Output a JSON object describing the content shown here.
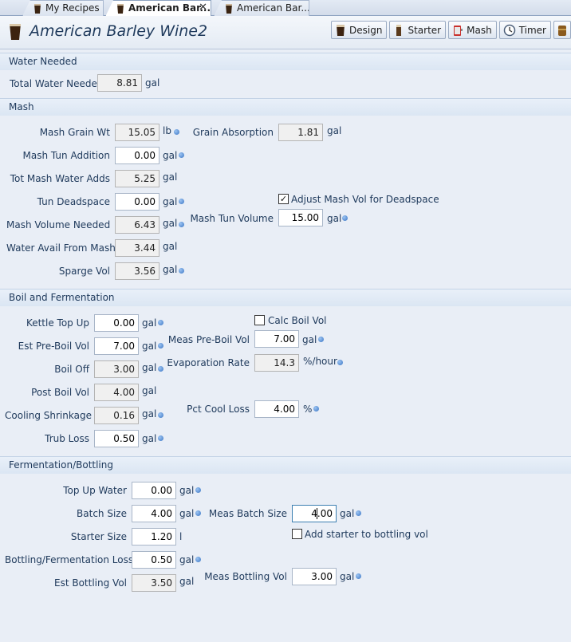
{
  "tabs": [
    {
      "label": "My Recipes"
    },
    {
      "label": "American Bar...",
      "close": "✕"
    },
    {
      "label": "American Bar..."
    }
  ],
  "header": {
    "title": "American Barley Wine2",
    "toolbar": [
      "Design",
      "Starter",
      "Mash",
      "Timer"
    ]
  },
  "water": {
    "section": "Water Needed",
    "total_label": "Total Water Needed",
    "total_value": "8.81",
    "total_unit": "gal"
  },
  "mash": {
    "section": "Mash",
    "grain_wt_label": "Mash Grain Wt",
    "grain_wt_value": "15.05",
    "grain_wt_unit": "lb",
    "absorption_label": "Grain Absorption",
    "absorption_value": "1.81",
    "absorption_unit": "gal",
    "tun_addition_label": "Mash Tun Addition",
    "tun_addition_value": "0.00",
    "tun_addition_unit": "gal",
    "water_adds_label": "Tot Mash Water Adds",
    "water_adds_value": "5.25",
    "water_adds_unit": "gal",
    "deadspace_label": "Tun Deadspace",
    "deadspace_value": "0.00",
    "deadspace_unit": "gal",
    "adjust_label": "Adjust Mash Vol for Deadspace",
    "adjust_checked": "✓",
    "volume_needed_label": "Mash Volume Needed",
    "volume_needed_value": "6.43",
    "volume_needed_unit": "gal",
    "tun_volume_label": "Mash Tun Volume",
    "tun_volume_value": "15.00",
    "tun_volume_unit": "gal",
    "avail_label": "Water Avail From Mash",
    "avail_value": "3.44",
    "avail_unit": "gal",
    "sparge_label": "Sparge Vol",
    "sparge_value": "3.56",
    "sparge_unit": "gal"
  },
  "boil": {
    "section": "Boil and Fermentation",
    "kettle_label": "Kettle Top Up",
    "kettle_value": "0.00",
    "kettle_unit": "gal",
    "calc_label": "Calc Boil Vol",
    "est_pre_label": "Est Pre-Boil Vol",
    "est_pre_value": "7.00",
    "est_pre_unit": "gal",
    "meas_pre_label": "Meas Pre-Boil Vol",
    "meas_pre_value": "7.00",
    "meas_pre_unit": "gal",
    "boil_off_label": "Boil Off",
    "boil_off_value": "3.00",
    "boil_off_unit": "gal",
    "evap_label": "Evaporation Rate",
    "evap_value": "14.3",
    "evap_unit": "%/hour",
    "post_label": "Post Boil Vol",
    "post_value": "4.00",
    "post_unit": "gal",
    "shrink_label": "Cooling Shrinkage",
    "shrink_value": "0.16",
    "shrink_unit": "gal",
    "cool_loss_label": "Pct Cool Loss",
    "cool_loss_value": "4.00",
    "cool_loss_unit": "%",
    "trub_label": "Trub Loss",
    "trub_value": "0.50",
    "trub_unit": "gal"
  },
  "ferm": {
    "section": "Fermentation/Bottling",
    "topup_label": "Top Up Water",
    "topup_value": "0.00",
    "topup_unit": "gal",
    "batch_label": "Batch Size",
    "batch_value": "4.00",
    "batch_unit": "gal",
    "meas_batch_label": "Meas Batch Size",
    "meas_batch_value": "4.00",
    "meas_batch_unit": "gal",
    "starter_label": "Starter Size",
    "starter_value": "1.20",
    "starter_unit": "l",
    "add_starter_label": "Add starter to bottling vol",
    "loss_label": "Bottling/Fermentation Loss",
    "loss_value": "0.50",
    "loss_unit": "gal",
    "est_bottle_label": "Est Bottling Vol",
    "est_bottle_value": "3.50",
    "est_bottle_unit": "gal",
    "meas_bottle_label": "Meas Bottling Vol",
    "meas_bottle_value": "3.00",
    "meas_bottle_unit": "gal"
  }
}
